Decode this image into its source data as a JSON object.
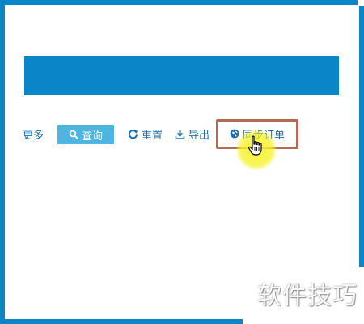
{
  "toolbar": {
    "more_label": "更多",
    "query_label": "查询",
    "reset_label": "重置",
    "export_label": "导出",
    "sync_label": "同步订单"
  },
  "icons": {
    "query": "search-icon",
    "reset": "refresh-icon",
    "export": "download-icon",
    "sync": "globe-icon",
    "cursor": "hand-pointer-icon"
  },
  "colors": {
    "frame": "#0a85c8",
    "banner": "#0a85c8",
    "query_button": "#4fb5e0",
    "toolbar_text": "#1f6fa6",
    "highlight_box": "#b46a55",
    "cursor_glow": "#f6f228"
  },
  "watermark": {
    "text": "软件技巧"
  }
}
